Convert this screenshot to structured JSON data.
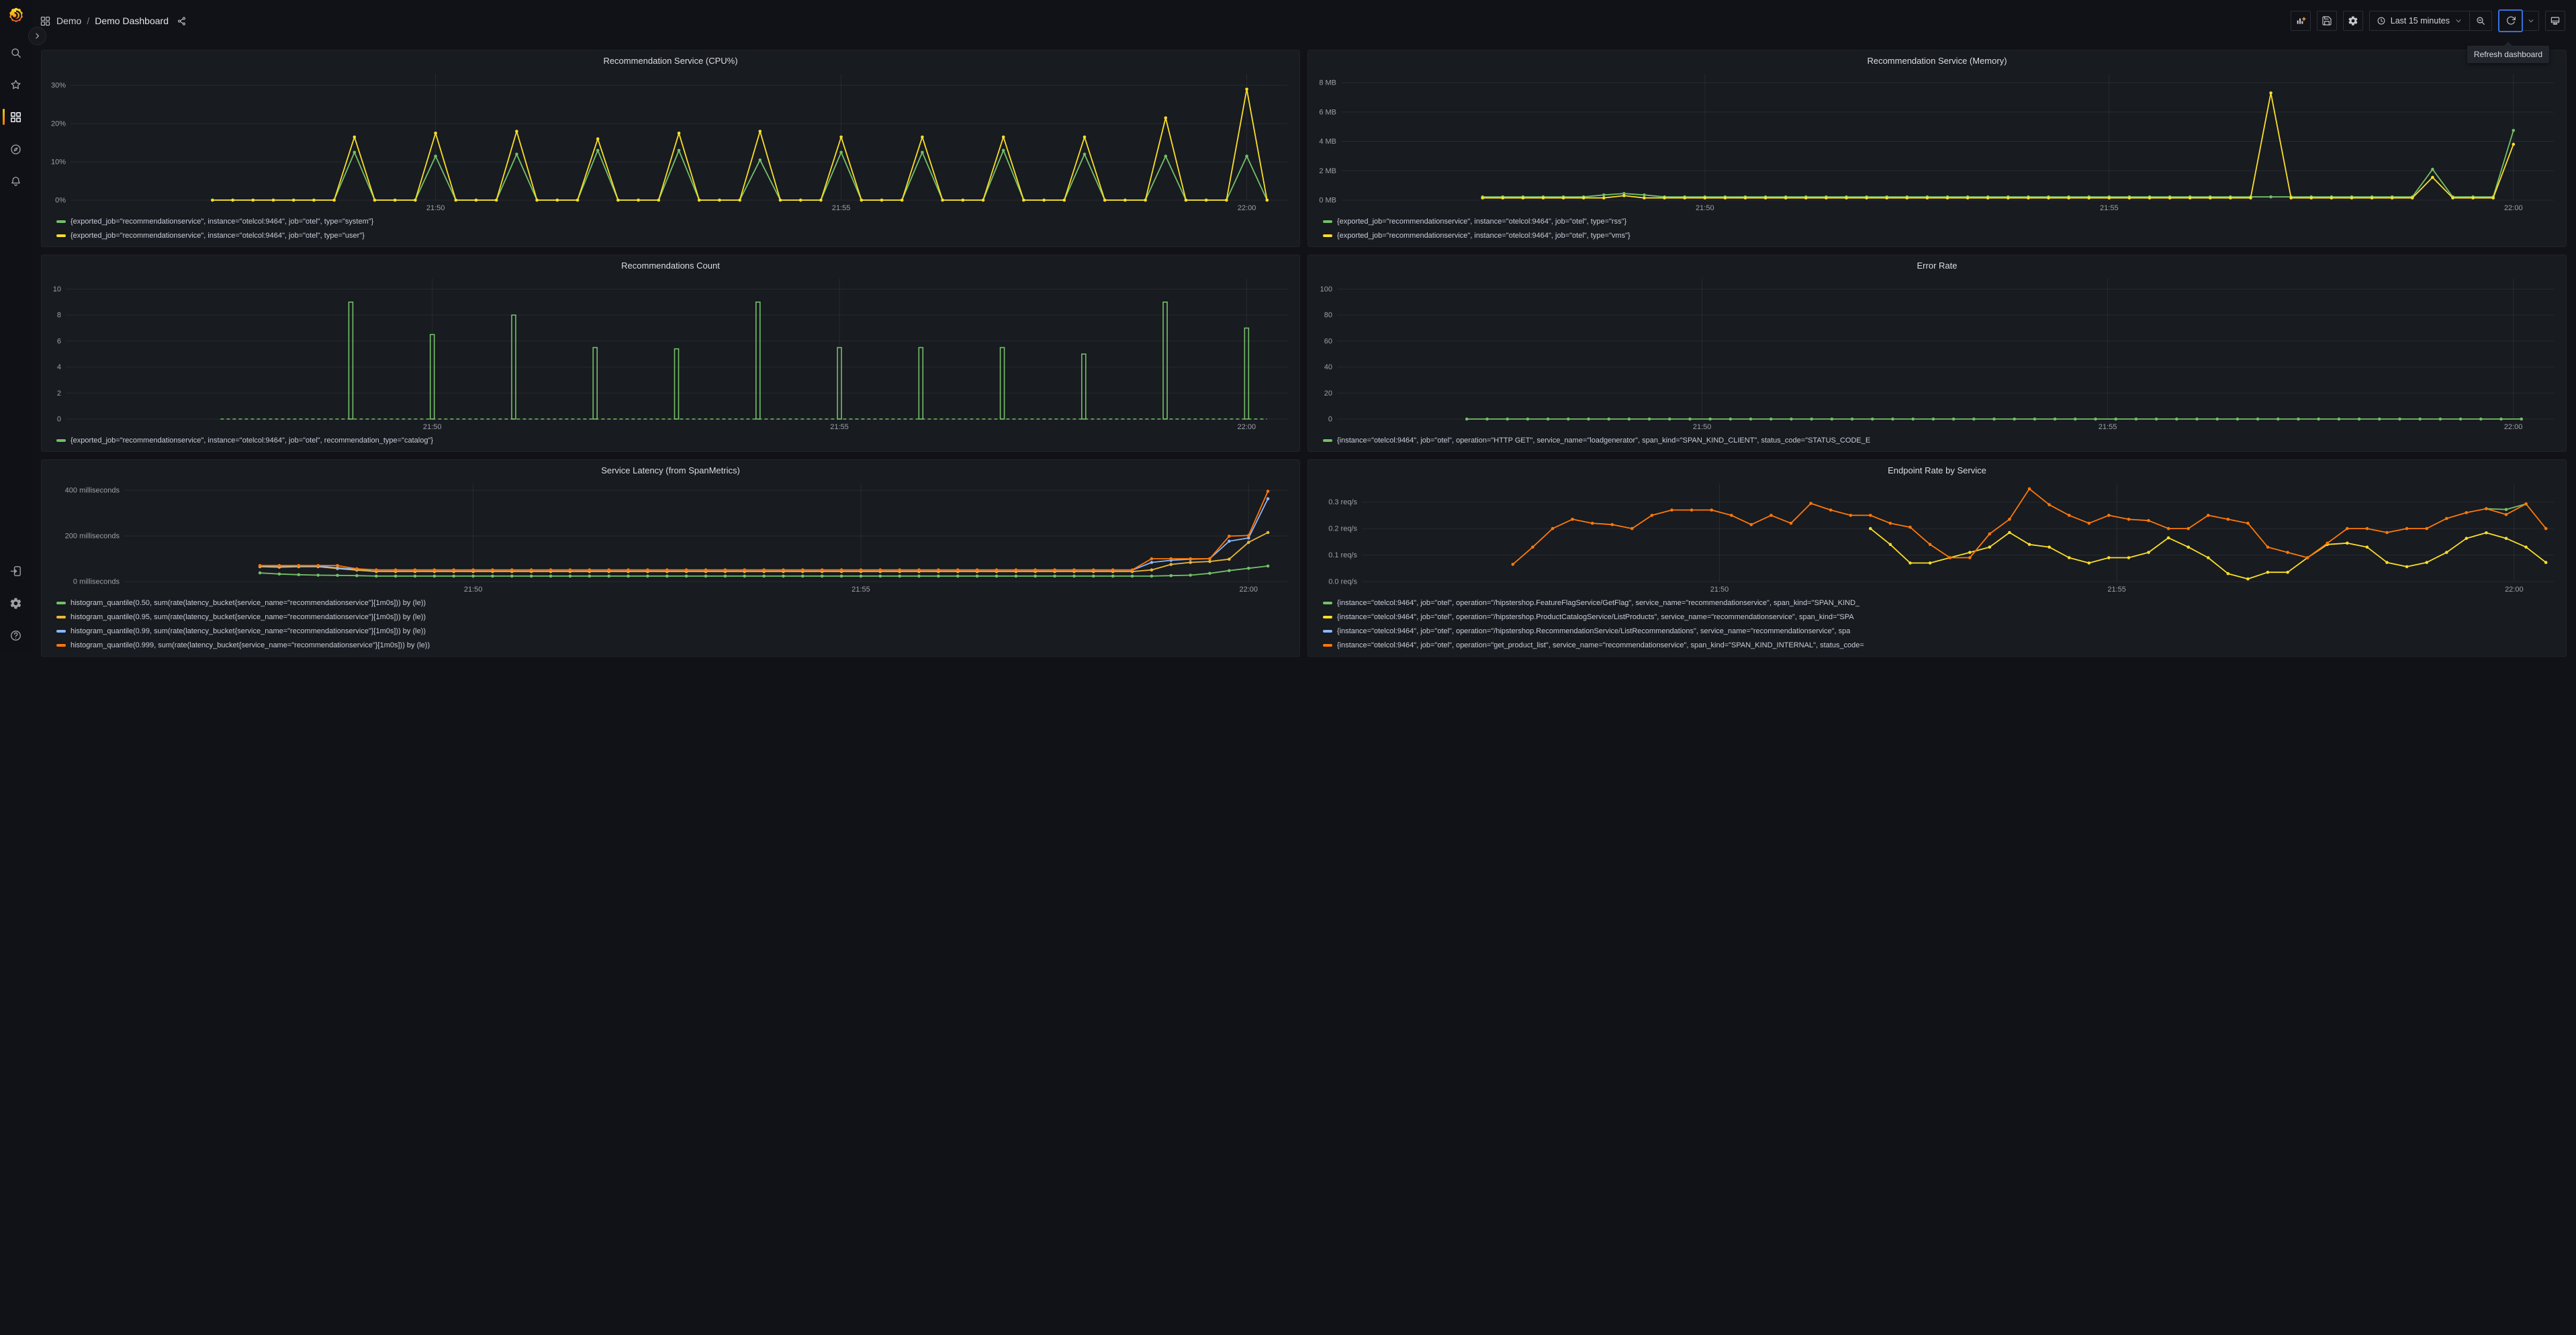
{
  "topbar": {
    "breadcrumb": {
      "root": "Demo",
      "separator": "/",
      "current": "Demo Dashboard"
    },
    "time_picker": {
      "label": "Last 15 minutes"
    },
    "tooltip": {
      "text": "Refresh dashboard"
    }
  },
  "icons": {
    "sidebar": [
      "grafana-logo",
      "search-icon",
      "star-icon",
      "dashboards-icon",
      "explore-compass-icon",
      "alerting-bell-icon",
      "sign-in-icon",
      "gear-icon",
      "help-icon"
    ],
    "topbar": [
      "apps-grid-icon",
      "share-icon",
      "add-panel-icon",
      "save-dashboard-icon",
      "dashboard-settings-icon",
      "clock-icon",
      "chevron-down-icon",
      "zoom-out-icon",
      "refresh-icon",
      "kiosk-monitor-icon"
    ]
  },
  "colors": {
    "green": "#73bf69",
    "yellow": "#fade2a",
    "yellow_dark": "#eab839",
    "blue": "#8ab8ff",
    "orange": "#ff780a",
    "focus_blue": "#3871dc",
    "accent": "#ff780a"
  },
  "chart_data": [
    {
      "type": "line",
      "title": "Recommendation Service (CPU%)",
      "x_note": "x = minutes after 21:45:30, domain is the Last-15-minutes window",
      "x_domain": [
        0,
        15
      ],
      "x_tick_minutes": [
        4.5,
        9.5,
        14.5
      ],
      "x_tick_labels": [
        "21:50",
        "21:55",
        "22:00"
      ],
      "y_ticks": [
        0,
        10,
        20,
        30
      ],
      "y_tick_labels": [
        "0%",
        "10%",
        "20%",
        "30%"
      ],
      "y_max": 33,
      "series": [
        {
          "name": "type system",
          "color": "#73bf69",
          "encoding": "baseline_peaks",
          "baseline": 0,
          "x_start": 1.75,
          "x_end": 14.75,
          "x_step": 0.25,
          "peaks": [
            [
              3.5,
              12.5
            ],
            [
              4.5,
              11.5
            ],
            [
              5.5,
              12
            ],
            [
              6.5,
              13
            ],
            [
              7.5,
              13
            ],
            [
              8.5,
              10.5
            ],
            [
              9.5,
              12.5
            ],
            [
              10.5,
              12.5
            ],
            [
              11.5,
              13
            ],
            [
              12.5,
              12
            ],
            [
              13.5,
              11.5
            ],
            [
              14.5,
              11.5
            ]
          ]
        },
        {
          "name": "type user",
          "color": "#fade2a",
          "encoding": "baseline_peaks",
          "baseline": 0,
          "x_start": 1.75,
          "x_end": 14.75,
          "x_step": 0.25,
          "peaks": [
            [
              3.5,
              16.5
            ],
            [
              4.5,
              17.5
            ],
            [
              5.5,
              18
            ],
            [
              6.5,
              16
            ],
            [
              7.5,
              17.5
            ],
            [
              8.5,
              18
            ],
            [
              9.5,
              16.5
            ],
            [
              10.5,
              16.5
            ],
            [
              11.5,
              16.5
            ],
            [
              12.5,
              16.5
            ],
            [
              13.5,
              21.5
            ],
            [
              14.5,
              29
            ]
          ]
        }
      ],
      "legend": [
        {
          "color": "#73bf69",
          "label": "{exported_job=\"recommendationservice\", instance=\"otelcol:9464\", job=\"otel\", type=\"system\"}"
        },
        {
          "color": "#fade2a",
          "label": "{exported_job=\"recommendationservice\", instance=\"otelcol:9464\", job=\"otel\", type=\"user\"}"
        }
      ]
    },
    {
      "type": "line",
      "title": "Recommendation Service (Memory)",
      "x_domain": [
        0,
        15
      ],
      "x_tick_minutes": [
        4.5,
        9.5,
        14.5
      ],
      "x_tick_labels": [
        "21:50",
        "21:55",
        "22:00"
      ],
      "y_ticks": [
        0,
        2,
        4,
        6,
        8
      ],
      "y_tick_labels": [
        "0 MB",
        "2 MB",
        "4 MB",
        "6 MB",
        "8 MB"
      ],
      "y_max": 8.6,
      "series": [
        {
          "name": "type rss",
          "color": "#73bf69",
          "encoding": "baseline_peaks",
          "baseline": 0.22,
          "x_start": 1.75,
          "x_end": 14.5,
          "x_step": 0.25,
          "peaks": [
            [
              3.25,
              0.35
            ],
            [
              3.5,
              0.45
            ],
            [
              3.75,
              0.35
            ],
            [
              13.5,
              2.1
            ],
            [
              14.5,
              4.75
            ]
          ]
        },
        {
          "name": "type vms",
          "color": "#fade2a",
          "encoding": "baseline_peaks",
          "baseline": 0.15,
          "x_start": 1.75,
          "x_end": 14.5,
          "x_step": 0.25,
          "peaks": [
            [
              3.5,
              0.3
            ],
            [
              11.5,
              7.3
            ],
            [
              13.5,
              1.55
            ],
            [
              14.5,
              3.8
            ]
          ]
        }
      ],
      "legend": [
        {
          "color": "#73bf69",
          "label": "{exported_job=\"recommendationservice\", instance=\"otelcol:9464\", job=\"otel\", type=\"rss\"}"
        },
        {
          "color": "#fade2a",
          "label": "{exported_job=\"recommendationservice\", instance=\"otelcol:9464\", job=\"otel\", type=\"vms\"}"
        }
      ]
    },
    {
      "type": "bars",
      "title": "Recommendations Count",
      "x_domain": [
        0,
        15
      ],
      "x_tick_minutes": [
        4.5,
        9.5,
        14.5
      ],
      "x_tick_labels": [
        "21:50",
        "21:55",
        "22:00"
      ],
      "y_ticks": [
        0,
        2,
        4,
        6,
        8,
        10
      ],
      "y_tick_labels": [
        "0",
        "2",
        "4",
        "6",
        "8",
        "10"
      ],
      "y_max": 10.8,
      "bar_color": "#73bf69",
      "bars": [
        [
          3.5,
          9
        ],
        [
          4.5,
          6.5
        ],
        [
          5.5,
          8
        ],
        [
          6.5,
          5.5
        ],
        [
          7.5,
          5.4
        ],
        [
          8.5,
          9
        ],
        [
          9.5,
          5.5
        ],
        [
          10.5,
          5.5
        ],
        [
          11.5,
          5.5
        ],
        [
          12.5,
          5
        ],
        [
          13.5,
          9
        ],
        [
          14.5,
          7
        ]
      ],
      "baseline_dash": {
        "y": 0,
        "x_start": 1.9,
        "x_end": 14.75
      },
      "series": [],
      "legend": [
        {
          "color": "#73bf69",
          "label": "{exported_job=\"recommendationservice\", instance=\"otelcol:9464\", job=\"otel\", recommendation_type=\"catalog\"}"
        }
      ]
    },
    {
      "type": "line",
      "title": "Error Rate",
      "x_domain": [
        0,
        15
      ],
      "x_tick_minutes": [
        4.5,
        9.5,
        14.5
      ],
      "x_tick_labels": [
        "21:50",
        "21:55",
        "22:00"
      ],
      "y_ticks": [
        0,
        20,
        40,
        60,
        80,
        100
      ],
      "y_tick_labels": [
        "0",
        "20",
        "40",
        "60",
        "80",
        "100"
      ],
      "y_max": 108,
      "series": [
        {
          "name": "HTTP GET errors",
          "color": "#73bf69",
          "encoding": "baseline_peaks",
          "baseline": 0,
          "x_start": 1.6,
          "x_end": 14.6,
          "x_step": 0.25,
          "peaks": []
        }
      ],
      "legend": [
        {
          "color": "#73bf69",
          "label": "{instance=\"otelcol:9464\", job=\"otel\", operation=\"HTTP GET\", service_name=\"loadgenerator\", span_kind=\"SPAN_KIND_CLIENT\", status_code=\"STATUS_CODE_E"
        }
      ]
    },
    {
      "type": "line",
      "title": "Service Latency (from SpanMetrics)",
      "x_domain": [
        0,
        15
      ],
      "x_tick_minutes": [
        4.5,
        9.5,
        14.5
      ],
      "x_tick_labels": [
        "21:50",
        "21:55",
        "22:00"
      ],
      "y_ticks": [
        0,
        200,
        400
      ],
      "y_tick_labels": [
        "0 milliseconds",
        "200 milliseconds",
        "400 milliseconds"
      ],
      "y_max": 430,
      "series": [
        {
          "name": "p50",
          "color": "#73bf69",
          "encoding": "baseline_peaks",
          "baseline": 24,
          "x_start": 1.75,
          "x_end": 14.75,
          "x_step": 0.25,
          "peaks": [
            [
              1.75,
              38
            ],
            [
              2,
              33
            ],
            [
              2.25,
              30
            ],
            [
              2.5,
              28
            ],
            [
              2.75,
              27
            ],
            [
              3,
              26
            ],
            [
              13.5,
              26
            ],
            [
              13.75,
              28
            ],
            [
              14,
              36
            ],
            [
              14.25,
              48
            ],
            [
              14.5,
              58
            ],
            [
              14.75,
              68
            ]
          ]
        },
        {
          "name": "p95",
          "color": "#eab839",
          "encoding": "baseline_peaks",
          "baseline": 44,
          "x_start": 1.75,
          "x_end": 14.75,
          "x_step": 0.25,
          "peaks": [
            [
              1.75,
              65
            ],
            [
              2,
              63
            ],
            [
              2.25,
              65
            ],
            [
              2.5,
              65
            ],
            [
              2.75,
              57
            ],
            [
              3,
              50
            ],
            [
              13.25,
              51
            ],
            [
              13.5,
              75
            ],
            [
              13.75,
              84
            ],
            [
              14,
              88
            ],
            [
              14.25,
              98
            ],
            [
              14.5,
              172
            ],
            [
              14.75,
              215
            ]
          ]
        },
        {
          "name": "p99",
          "color": "#8ab8ff",
          "encoding": "baseline_peaks",
          "baseline": 50,
          "x_start": 1.75,
          "x_end": 14.75,
          "x_step": 0.25,
          "peaks": [
            [
              1.75,
              68
            ],
            [
              2,
              68
            ],
            [
              2.25,
              68
            ],
            [
              2.5,
              68
            ],
            [
              2.75,
              60
            ],
            [
              3,
              54
            ],
            [
              13.25,
              84
            ],
            [
              13.5,
              93
            ],
            [
              13.75,
              98
            ],
            [
              14,
              100
            ],
            [
              14.25,
              177
            ],
            [
              14.5,
              191
            ],
            [
              14.75,
              363
            ]
          ]
        },
        {
          "name": "p999",
          "color": "#ff780a",
          "encoding": "baseline_peaks",
          "baseline": 51,
          "x_start": 1.75,
          "x_end": 14.75,
          "x_step": 0.25,
          "peaks": [
            [
              1.75,
              70
            ],
            [
              2,
              70
            ],
            [
              2.25,
              70
            ],
            [
              2.5,
              70
            ],
            [
              2.75,
              70
            ],
            [
              3,
              56
            ],
            [
              13.25,
              100
            ],
            [
              13.5,
              100
            ],
            [
              13.75,
              100
            ],
            [
              14,
              100
            ],
            [
              14.25,
              199
            ],
            [
              14.5,
              202
            ],
            [
              14.75,
              396
            ]
          ]
        }
      ],
      "legend": [
        {
          "color": "#73bf69",
          "label": "histogram_quantile(0.50, sum(rate(latency_bucket{service_name=\"recommendationservice\"}[1m0s])) by (le))"
        },
        {
          "color": "#eab839",
          "label": "histogram_quantile(0.95, sum(rate(latency_bucket{service_name=\"recommendationservice\"}[1m0s])) by (le))"
        },
        {
          "color": "#8ab8ff",
          "label": "histogram_quantile(0.99, sum(rate(latency_bucket{service_name=\"recommendationservice\"}[1m0s])) by (le))"
        },
        {
          "color": "#ff780a",
          "label": "histogram_quantile(0.999, sum(rate(latency_bucket{service_name=\"recommendationservice\"}[1m0s])) by (le))"
        }
      ]
    },
    {
      "type": "line",
      "title": "Endpoint Rate by Service",
      "x_domain": [
        0,
        15
      ],
      "x_tick_minutes": [
        4.5,
        9.5,
        14.5
      ],
      "x_tick_labels": [
        "21:50",
        "21:55",
        "22:00"
      ],
      "y_ticks": [
        0,
        0.1,
        0.2,
        0.3
      ],
      "y_tick_labels": [
        "0.0 req/s",
        "0.1 req/s",
        "0.2 req/s",
        "0.3 req/s"
      ],
      "y_max": 0.37,
      "series": [
        {
          "name": "GetFlag",
          "color": "#73bf69",
          "encoding": "values",
          "x_start": 14.15,
          "x_step": 0.25,
          "values": [
            0.275,
            0.272,
            0.293
          ]
        },
        {
          "name": "ListProducts",
          "color": "#fade2a",
          "encoding": "values",
          "x_start": 6.4,
          "x_step": 0.25,
          "values": [
            0.2,
            0.14,
            0.07,
            0.07,
            0.09,
            0.11,
            0.13,
            0.185,
            0.14,
            0.13,
            0.09,
            0.07,
            0.09,
            0.09,
            0.11,
            0.165,
            0.13,
            0.09,
            0.03,
            0.01,
            0.035,
            0.035,
            0.09,
            0.14,
            0.145,
            0.13,
            0.072,
            0.056,
            0.072,
            0.11,
            0.163,
            0.184,
            0.163,
            0.13,
            0.072
          ]
        },
        {
          "name": "ListRecommendations",
          "color": "#8ab8ff",
          "encoding": "values",
          "x_start": 1.9,
          "x_step": 0.25,
          "values": []
        },
        {
          "name": "get_product_list",
          "color": "#ff780a",
          "encoding": "values",
          "x_start": 1.9,
          "x_step": 0.25,
          "values": [
            0.065,
            0.13,
            0.2,
            0.235,
            0.22,
            0.215,
            0.2,
            0.25,
            0.27,
            0.27,
            0.27,
            0.25,
            0.215,
            0.25,
            0.22,
            0.295,
            0.27,
            0.25,
            0.25,
            0.22,
            0.205,
            0.14,
            0.09,
            0.09,
            0.18,
            0.235,
            0.35,
            0.29,
            0.25,
            0.22,
            0.25,
            0.235,
            0.23,
            0.2,
            0.2,
            0.25,
            0.235,
            0.22,
            0.13,
            0.11,
            0.09,
            0.145,
            0.2,
            0.2,
            0.185,
            0.2,
            0.2,
            0.238,
            0.26,
            0.275,
            0.253,
            0.293,
            0.2
          ]
        }
      ],
      "legend": [
        {
          "color": "#73bf69",
          "label": "{instance=\"otelcol:9464\", job=\"otel\", operation=\"/hipstershop.FeatureFlagService/GetFlag\", service_name=\"recommendationservice\", span_kind=\"SPAN_KIND_"
        },
        {
          "color": "#fade2a",
          "label": "{instance=\"otelcol:9464\", job=\"otel\", operation=\"/hipstershop.ProductCatalogService/ListProducts\", service_name=\"recommendationservice\", span_kind=\"SPA"
        },
        {
          "color": "#8ab8ff",
          "label": "{instance=\"otelcol:9464\", job=\"otel\", operation=\"/hipstershop.RecommendationService/ListRecommendations\", service_name=\"recommendationservice\", spa"
        },
        {
          "color": "#ff780a",
          "label": "{instance=\"otelcol:9464\", job=\"otel\", operation=\"get_product_list\", service_name=\"recommendationservice\", span_kind=\"SPAN_KIND_INTERNAL\", status_code="
        }
      ]
    }
  ]
}
